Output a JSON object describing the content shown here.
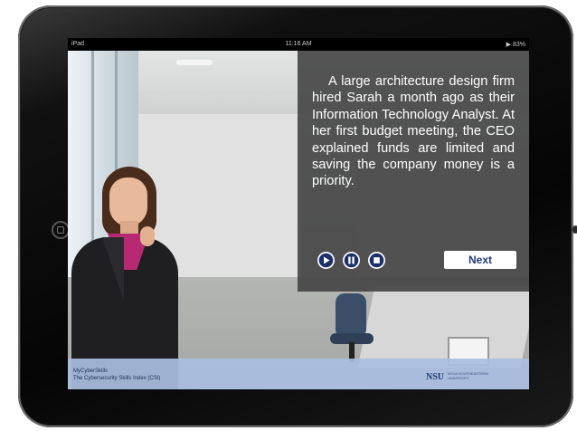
{
  "status_bar": {
    "left": "iPad",
    "time": "11:16 AM",
    "right": "▶ 83%"
  },
  "scene": {
    "narration": "A large architecture design firm hired Sarah a month ago as their Information Technology Analyst. At her first budget meeting, the CEO explained funds are limited and saving the company money is a priority."
  },
  "controls": {
    "play_icon": "play-icon",
    "pause_icon": "pause-icon",
    "stop_icon": "stop-icon",
    "next_label": "Next"
  },
  "footer": {
    "line1": "MyCyberSkills",
    "line2": "The Cybersecurity Skills Index (CSI)",
    "logo_text": "NSU",
    "logo_subtext": "NOVA SOUTHEASTERN UNIVERSITY"
  },
  "colors": {
    "panel": "#404040",
    "footer": "#aabee1",
    "accent": "#233a7a"
  }
}
